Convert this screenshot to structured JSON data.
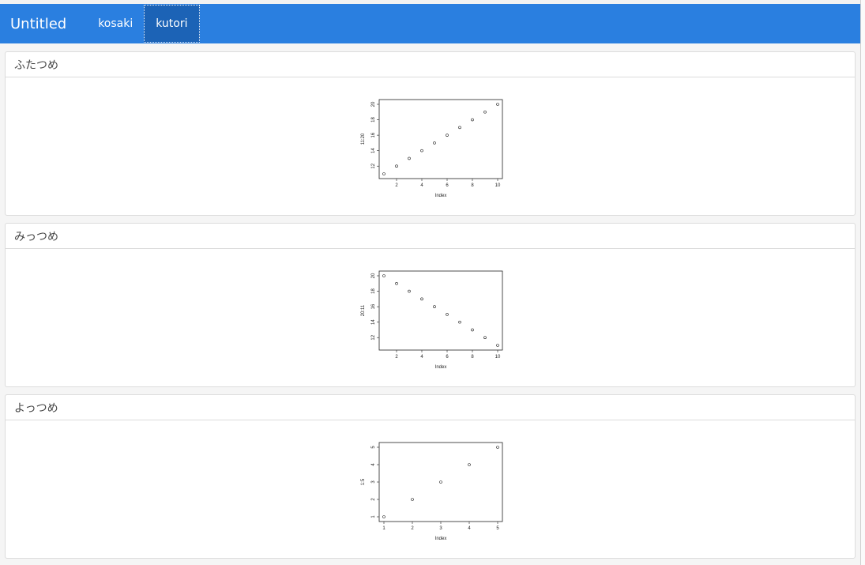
{
  "navbar": {
    "title": "Untitled",
    "tabs": [
      {
        "label": "kosaki",
        "active": false
      },
      {
        "label": "kutori",
        "active": true
      }
    ]
  },
  "panels": [
    {
      "title": "ふたつめ"
    },
    {
      "title": "みっつめ"
    },
    {
      "title": "よっつめ"
    }
  ],
  "colors": {
    "navbar": "#2a7fe0",
    "active_tab": "#1c63b6"
  },
  "chart_data": [
    {
      "type": "scatter",
      "x": [
        1,
        2,
        3,
        4,
        5,
        6,
        7,
        8,
        9,
        10
      ],
      "y": [
        11,
        12,
        13,
        14,
        15,
        16,
        17,
        18,
        19,
        20
      ],
      "xlabel": "Index",
      "ylabel": "11:20",
      "xticks": [
        2,
        4,
        6,
        8,
        10
      ],
      "yticks": [
        12,
        14,
        16,
        18,
        20
      ],
      "xlim": [
        1,
        10
      ],
      "ylim": [
        11,
        20
      ]
    },
    {
      "type": "scatter",
      "x": [
        1,
        2,
        3,
        4,
        5,
        6,
        7,
        8,
        9,
        10
      ],
      "y": [
        20,
        19,
        18,
        17,
        16,
        15,
        14,
        13,
        12,
        11
      ],
      "xlabel": "Index",
      "ylabel": "20:11",
      "xticks": [
        2,
        4,
        6,
        8,
        10
      ],
      "yticks": [
        12,
        14,
        16,
        18,
        20
      ],
      "xlim": [
        1,
        10
      ],
      "ylim": [
        11,
        20
      ]
    },
    {
      "type": "scatter",
      "x": [
        1,
        2,
        3,
        4,
        5
      ],
      "y": [
        1,
        2,
        3,
        4,
        5
      ],
      "xlabel": "Index",
      "ylabel": "1:5",
      "xticks": [
        1,
        2,
        3,
        4,
        5
      ],
      "yticks": [
        1,
        2,
        3,
        4,
        5
      ],
      "xlim": [
        1,
        5
      ],
      "ylim": [
        1,
        5
      ]
    }
  ]
}
